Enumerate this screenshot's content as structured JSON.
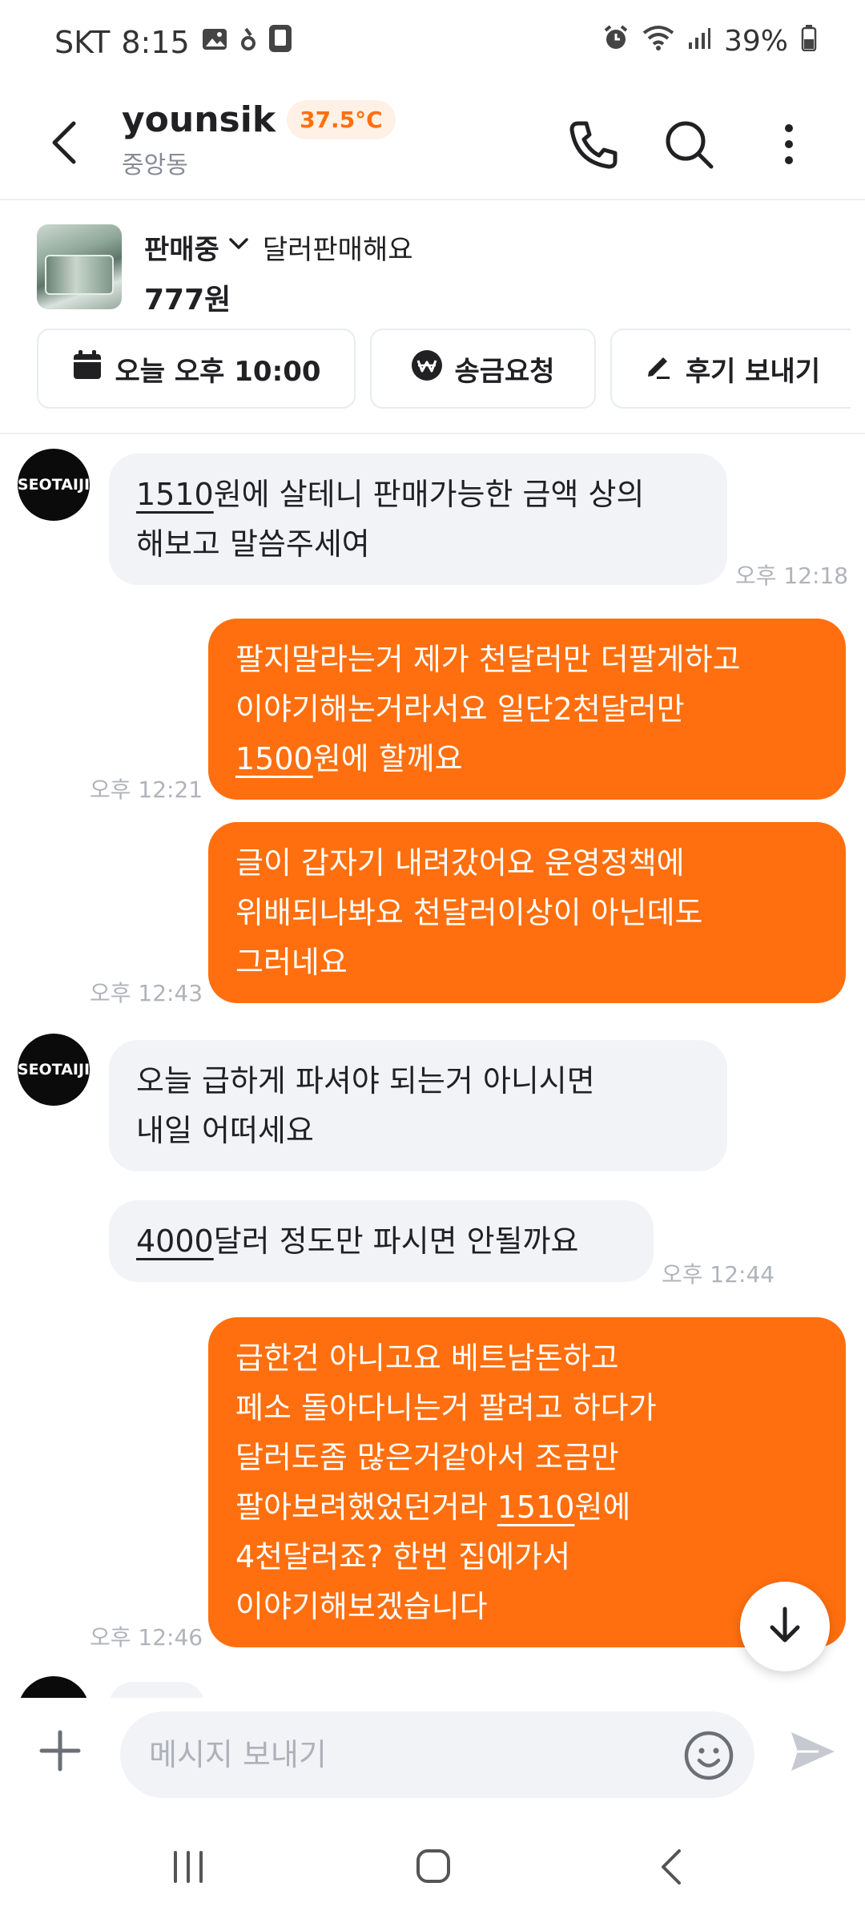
{
  "status_bar": {
    "carrier": "SKT",
    "time": "8:15",
    "battery": "39%"
  },
  "header": {
    "title": "younsik",
    "temperature": "37.5°C",
    "subtitle": "중앙동"
  },
  "product": {
    "status": "판매중",
    "title": "달러판매해요",
    "price": "777원"
  },
  "actions": {
    "schedule": "오늘 오후 10:00",
    "remit": "송금요청",
    "review": "후기 보내기"
  },
  "messages": [
    {
      "from": "them",
      "avatar_text": "SEOTAIJI",
      "pre": "",
      "u": "1510",
      "post": "원에 살테니 판매가능한 금액 상의\n해보고 말씀주세여",
      "time": "오후 12:18"
    },
    {
      "from": "me",
      "pre": "팔지말라는거 제가 천달러만 더팔게하고\n이야기해논거라서요 일단2천달러만\n",
      "u": "1500",
      "post": "원에 할께요",
      "time": "오후 12:21"
    },
    {
      "from": "me",
      "pre": "",
      "u": "",
      "post": "글이 갑자기 내려갔어요 운영정책에\n위배되나봐요 천달러이상이 아닌데도\n그러네요",
      "time": "오후 12:43"
    },
    {
      "from": "them",
      "avatar_text": "SEOTAIJI",
      "pre": "",
      "u": "",
      "post": "오늘 급하게 파셔야 되는거 아니시면\n내일 어떠세요",
      "time": ""
    },
    {
      "from": "them",
      "pre": "",
      "u": "4000",
      "post": "달러 정도만 파시면 안될까요",
      "time": "오후 12:44"
    },
    {
      "from": "me",
      "pre": "급한건 아니고요 베트남돈하고\n페소 돌아다니는거 팔려고 하다가\n달러도좀 많은거같아서 조금만\n팔아보려했었던거라 ",
      "u": "1510",
      "post": "원에\n4천달러죠? 한번 집에가서\n이야기해보겠습니다",
      "time": "오후 12:46"
    }
  ],
  "composer": {
    "placeholder": "메시지 보내기"
  },
  "colors": {
    "accent": "#ff6f0f",
    "incoming_bubble": "#f2f3f6",
    "timestamp": "#b0b3ba"
  }
}
